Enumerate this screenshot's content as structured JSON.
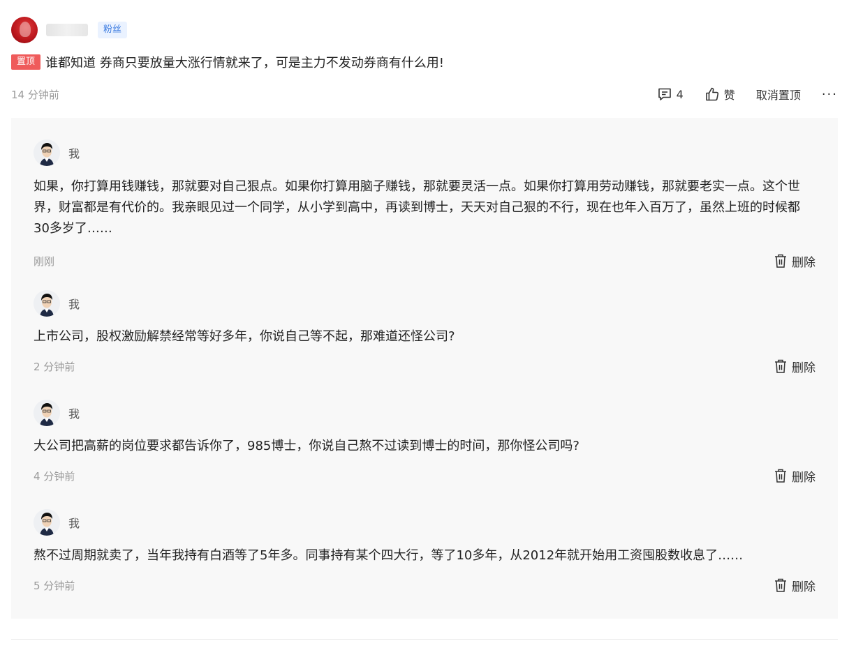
{
  "post": {
    "badge": "粉丝",
    "pin_label": "置顶",
    "title": "谁都知道 券商只要放量大涨行情就来了，可是主力不发动券商有什么用!",
    "time": "14 分钟前",
    "comment_count": "4",
    "like_label": "赞",
    "unpin_label": "取消置顶",
    "more_label": "···"
  },
  "replies": [
    {
      "name": "我",
      "text": "如果，你打算用钱赚钱，那就要对自己狠点。如果你打算用脑子赚钱，那就要灵活一点。如果你打算用劳动赚钱，那就要老实一点。这个世界，财富都是有代价的。我亲眼见过一个同学，从小学到高中，再读到博士，天天对自己狠的不行，现在也年入百万了，虽然上班的时候都30多岁了……",
      "time": "刚刚",
      "delete_label": "删除"
    },
    {
      "name": "我",
      "text": "上市公司，股权激励解禁经常等好多年，你说自己等不起，那难道还怪公司?",
      "time": "2 分钟前",
      "delete_label": "删除"
    },
    {
      "name": "我",
      "text": "大公司把高薪的岗位要求都告诉你了，985博士，你说自己熬不过读到博士的时间，那你怪公司吗?",
      "time": "4 分钟前",
      "delete_label": "删除"
    },
    {
      "name": "我",
      "text": "熬不过周期就卖了，当年我持有白酒等了5年多。同事持有某个四大行，等了10多年，从2012年就开始用工资囤股数收息了……",
      "time": "5 分钟前",
      "delete_label": "删除"
    }
  ],
  "icons": {
    "comment": "comment-icon",
    "like": "thumbs-up-icon",
    "delete": "trash-icon"
  }
}
